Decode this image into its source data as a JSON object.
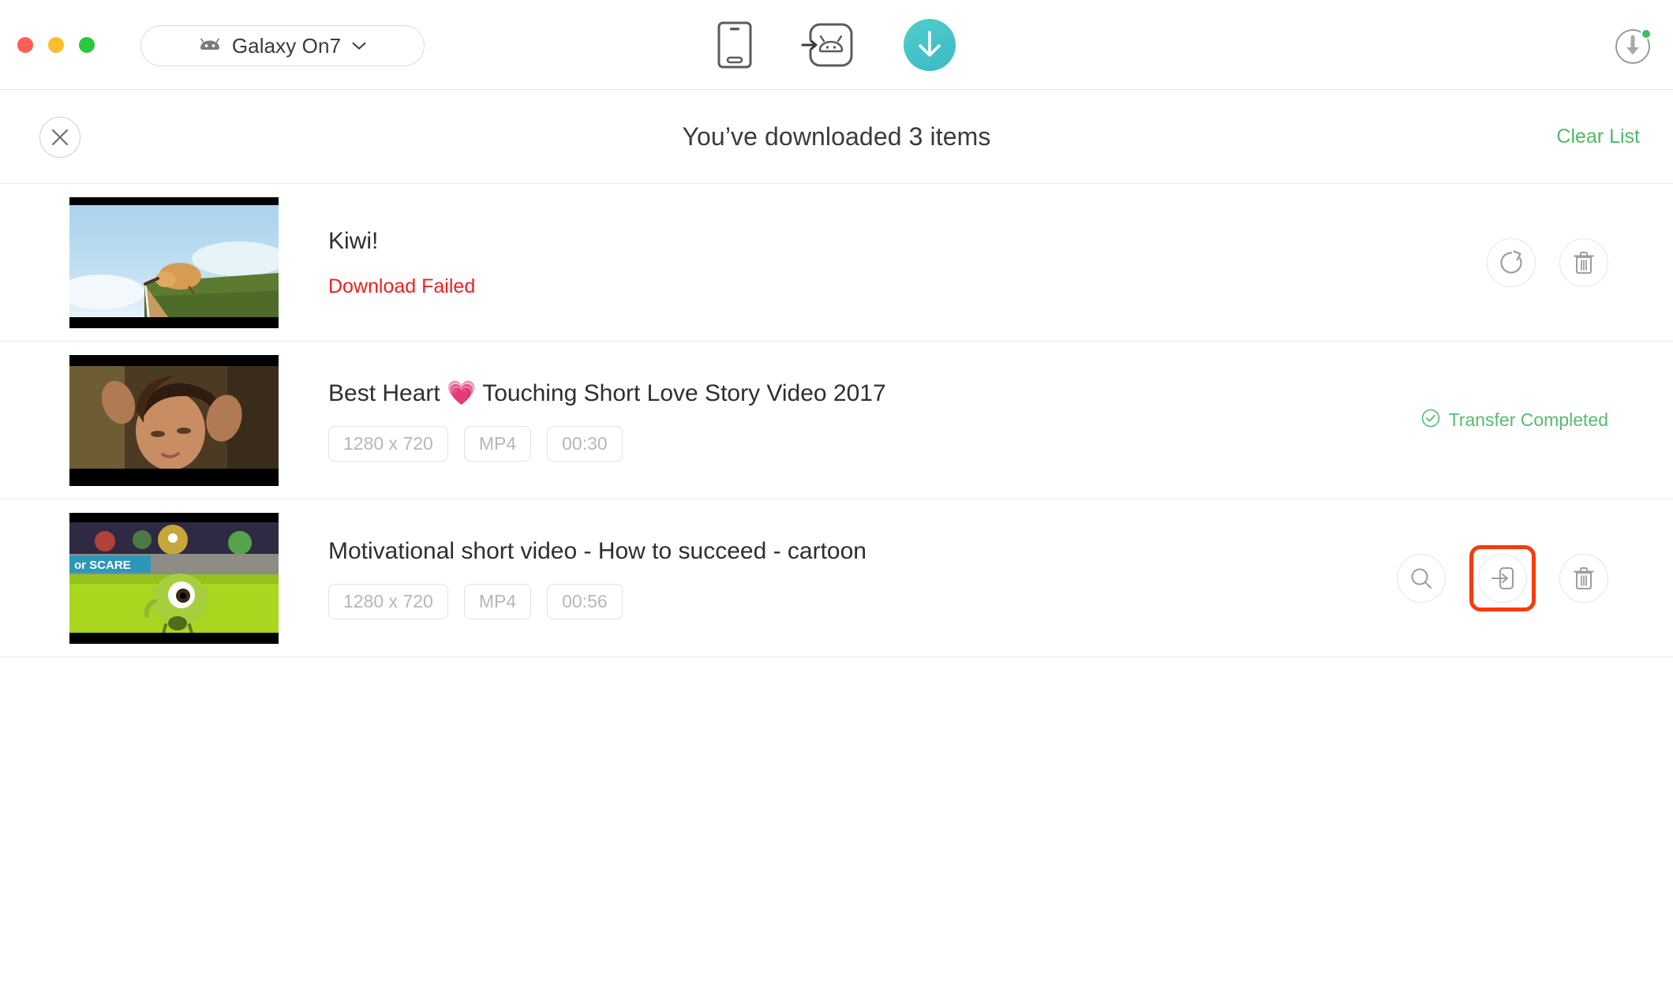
{
  "window": {
    "traffic_lights": [
      "close",
      "minimize",
      "maximize"
    ],
    "colors": {
      "red": "#ff5f57",
      "yellow": "#febc2e",
      "green": "#28c840",
      "accent_teal": "#3cb8c6",
      "accent_green": "#4cb964",
      "error_red": "#f01f1f",
      "highlight_red": "#f93a0b"
    }
  },
  "toolbar": {
    "device_selector": {
      "icon": "android-head-icon",
      "label": "Galaxy On7",
      "chevron": "chevron-down-icon"
    },
    "tools": [
      {
        "icon": "phone-device-icon",
        "label": ""
      },
      {
        "icon": "transfer-to-android-icon",
        "label": ""
      },
      {
        "icon": "download-arrow-icon",
        "label": "",
        "active": true
      }
    ],
    "downloads_button": {
      "icon": "download-circle-icon",
      "badge": true
    }
  },
  "subheader": {
    "close_icon": "close-icon",
    "title": "You’ve downloaded 3 items",
    "clear_list_label": "Clear List"
  },
  "downloads": [
    {
      "thumbnail": "kiwi-bird-cliff-thumbnail",
      "title": "Kiwi!",
      "status_type": "failed",
      "status_text": "Download Failed",
      "chips": [],
      "actions": [
        {
          "icon": "retry-icon",
          "highlighted": false
        },
        {
          "icon": "trash-icon",
          "highlighted": false
        }
      ]
    },
    {
      "thumbnail": "woman-portrait-thumbnail",
      "title": "Best Heart 💗 Touching Short Love Story Video 2017",
      "status_type": "completed",
      "status_text": "Transfer Completed",
      "status_icon": "check-circle-icon",
      "chips": [
        "1280 x 720",
        "MP4",
        "00:30"
      ],
      "actions": []
    },
    {
      "thumbnail": "monsters-university-thumbnail",
      "title": "Motivational short video - How to succeed - cartoon",
      "status_type": "none",
      "status_text": "",
      "chips": [
        "1280 x 720",
        "MP4",
        "00:56"
      ],
      "actions": [
        {
          "icon": "search-icon",
          "highlighted": false
        },
        {
          "icon": "transfer-to-device-icon",
          "highlighted": true
        },
        {
          "icon": "trash-icon",
          "highlighted": false
        }
      ]
    }
  ]
}
